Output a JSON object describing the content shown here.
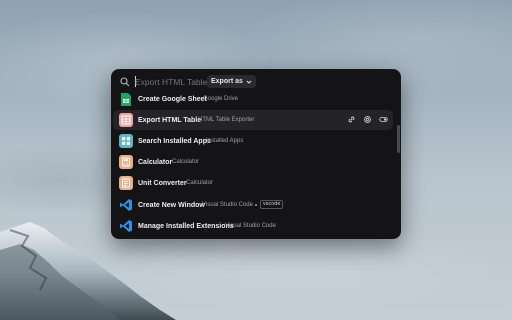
{
  "search": {
    "placeholder": "Export HTML Table",
    "dropdown_label": "Export as"
  },
  "results": [
    {
      "title": "Create Google Sheet",
      "subtitle": "Google Drive",
      "icon": "google-sheets-icon"
    },
    {
      "title": "Export HTML Table",
      "subtitle": "HTML Table Exporter",
      "icon": "table-exporter-icon",
      "selected": true
    },
    {
      "title": "Search Installed Apps",
      "subtitle": "Installed Apps",
      "icon": "apps-grid-icon"
    },
    {
      "title": "Calculator",
      "subtitle": "Calculator",
      "icon": "calculator-icon"
    },
    {
      "title": "Unit Converter",
      "subtitle": "Calculator",
      "icon": "unit-converter-icon"
    },
    {
      "title": "Create New Window",
      "subtitle": "Visual Studio Code",
      "tag": "vscode",
      "icon": "vscode-icon"
    },
    {
      "title": "Manage Installed Extensions",
      "subtitle": "Visual Studio Code",
      "icon": "vscode-icon"
    }
  ],
  "selected_actions": [
    "link-icon",
    "settings-icon",
    "toggle-icon"
  ],
  "colors": {
    "panel": "#141416",
    "selected_row": "#242428",
    "sheets_green": "#1fa463",
    "exporter_pink": "#e9a6a6",
    "apps_teal": "#5fb7c4",
    "calculator_peach": "#e7b08c",
    "vscode_blue": "#2f8ee6"
  }
}
